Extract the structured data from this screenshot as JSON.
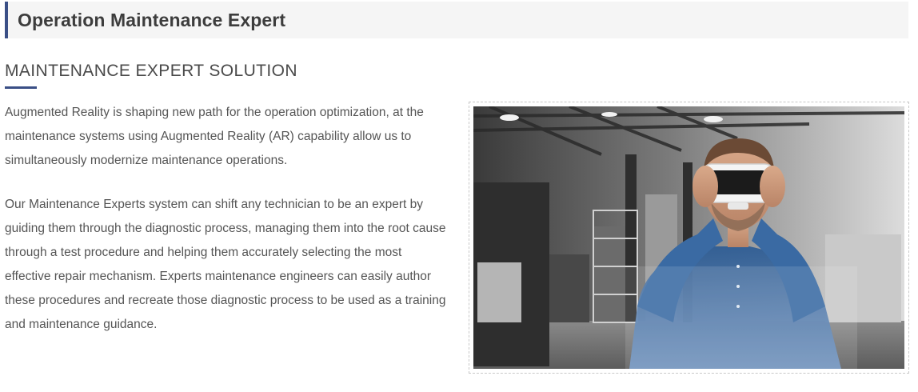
{
  "header": {
    "title": "Operation Maintenance Expert"
  },
  "section": {
    "heading": "MAINTENANCE EXPERT SOLUTION"
  },
  "content": {
    "paragraphs": [
      "Augmented Reality is shaping new path for the operation optimization, at the maintenance systems using Augmented Reality (AR) capability allow us to simultaneously modernize maintenance operations.",
      "Our Maintenance Experts system can shift any technician to be an expert by guiding them through the diagnostic process, managing them into the root cause through a test procedure and helping them accurately selecting the most effective repair mechanism. Experts maintenance engineers can easily author these procedures and recreate those diagnostic process to be used as a training and maintenance guidance."
    ]
  },
  "image": {
    "subject": "man-wearing-vr-headset-in-factory"
  },
  "colors": {
    "accent": "#3a4f86",
    "title_bar_bg": "#f5f5f5",
    "text": "#555555",
    "denim": "#2f5d94"
  }
}
